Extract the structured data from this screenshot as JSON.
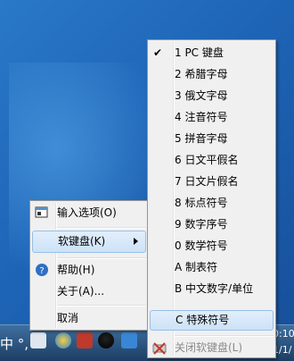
{
  "main_menu": {
    "items": [
      {
        "text": "输入选项(O)",
        "name": "menu-item-input-options"
      },
      {
        "text": "软键盘(K)",
        "name": "menu-item-soft-keyboard"
      },
      {
        "text": "帮助(H)",
        "name": "menu-item-help"
      },
      {
        "text": "关于(A)...",
        "name": "menu-item-about"
      },
      {
        "text": "取消",
        "name": "menu-item-cancel"
      }
    ]
  },
  "sub_menu": {
    "items": [
      {
        "text": "1 PC 键盘",
        "checked": true
      },
      {
        "text": "2 希腊字母"
      },
      {
        "text": "3 俄文字母"
      },
      {
        "text": "4 注音符号"
      },
      {
        "text": "5 拼音字母"
      },
      {
        "text": "6 日文平假名"
      },
      {
        "text": "7 日文片假名"
      },
      {
        "text": "8 标点符号"
      },
      {
        "text": "9 数字序号"
      },
      {
        "text": "0 数学符号"
      },
      {
        "text": "A 制表符"
      },
      {
        "text": "B 中文数字/单位"
      },
      {
        "text": "C 特殊符号",
        "highlighted": true
      },
      {
        "text": "关闭软键盘(L)",
        "disabled": true
      }
    ]
  },
  "taskbar": {
    "ime_text": "中 °,",
    "clock_line1": "0:10",
    "clock_line2": "1/1/"
  },
  "colors": {
    "desktop": "#1f66b8",
    "menu_bg": "#f0f0f0",
    "highlight": "#cde2f7",
    "disabled_text": "#8a8a8a"
  }
}
